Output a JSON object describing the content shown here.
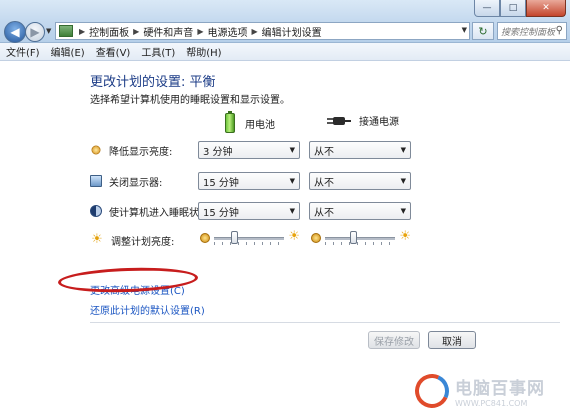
{
  "window": {
    "controls": {
      "minimize": "—",
      "maximize": "□",
      "close": "✕"
    }
  },
  "nav": {
    "back_icon": "back-arrow-icon",
    "forward_icon": "forward-arrow-icon",
    "breadcrumbs": [
      "控制面板",
      "硬件和声音",
      "电源选项",
      "编辑计划设置"
    ],
    "search_placeholder": "搜索控制面板"
  },
  "menu": [
    "文件(F)",
    "编辑(E)",
    "查看(V)",
    "工具(T)",
    "帮助(H)"
  ],
  "page": {
    "title": "更改计划的设置: 平衡",
    "subtitle": "选择希望计算机使用的睡眠设置和显示设置。",
    "columns": {
      "battery": "用电池",
      "plugged": "接通电源"
    },
    "rows": [
      {
        "label": "降低显示亮度:",
        "icon": "dim-display-icon",
        "battery": "3 分钟",
        "plugged": "从不"
      },
      {
        "label": "关闭显示器:",
        "icon": "monitor-icon",
        "battery": "15 分钟",
        "plugged": "从不"
      },
      {
        "label": "使计算机进入睡眠状态:",
        "icon": "sleep-icon",
        "battery": "15 分钟",
        "plugged": "从不"
      }
    ],
    "brightness": {
      "label": "调整计划亮度:",
      "icon": "sun-icon",
      "battery_level": 0.27,
      "plugged_level": 0.4
    },
    "links": {
      "advanced": "更改高级电源设置(C)",
      "restore": "还原此计划的默认设置(R)"
    },
    "buttons": {
      "save": "保存修改",
      "cancel": "取消"
    }
  },
  "annotation": {
    "color": "#c71d1d"
  },
  "watermark": {
    "cn": "电脑百事网",
    "en": "WWW.PC841.COM"
  }
}
